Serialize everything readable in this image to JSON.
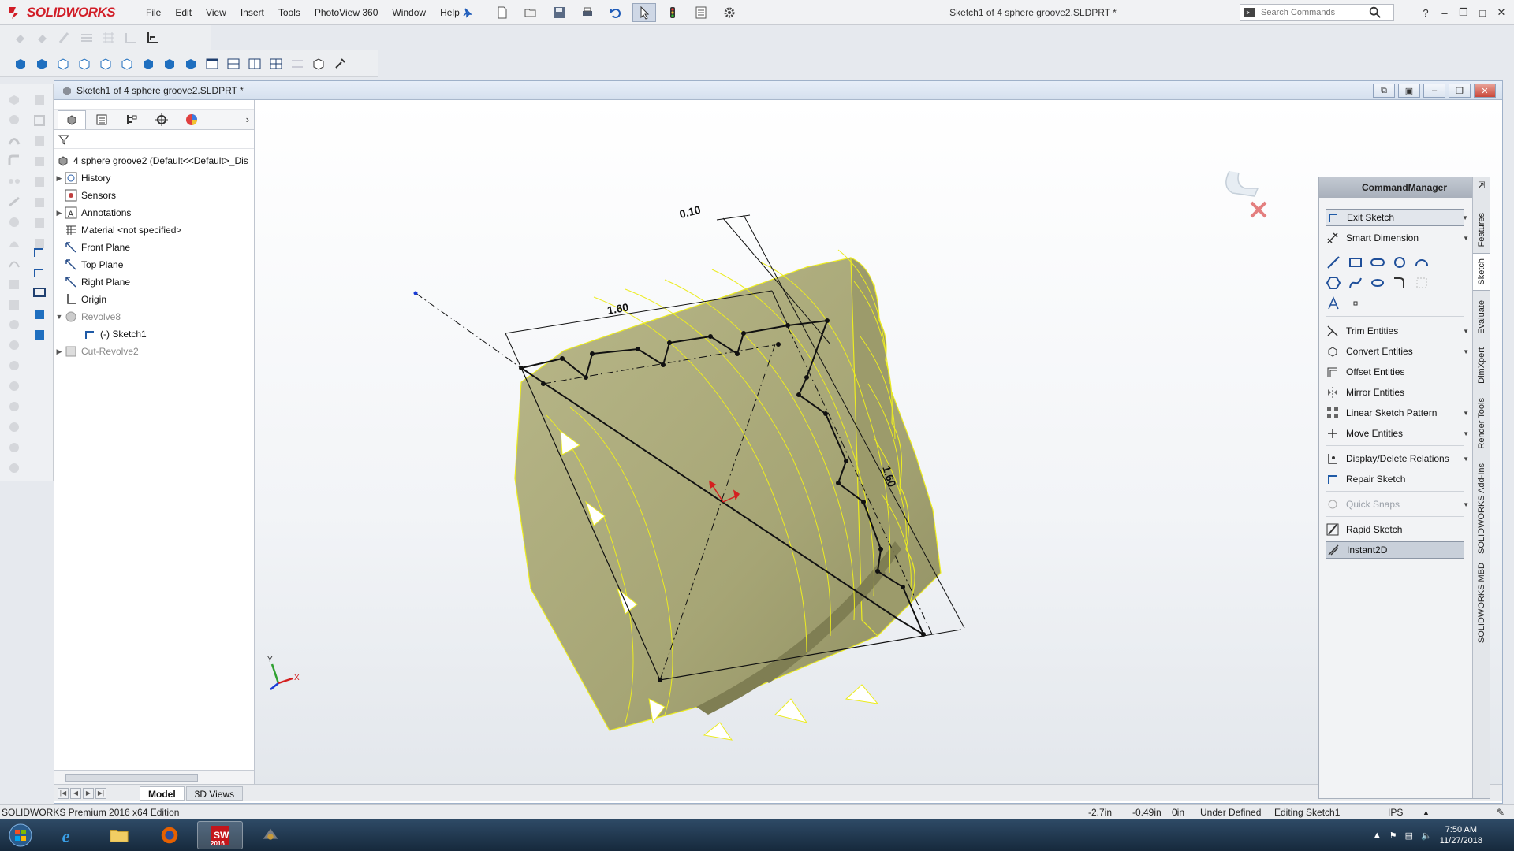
{
  "app": {
    "logo_text": "SOLIDWORKS",
    "window_title": "Sketch1 of 4 sphere groove2.SLDPRT *",
    "menu": [
      "File",
      "Edit",
      "View",
      "Insert",
      "Tools",
      "PhotoView 360",
      "Window",
      "Help"
    ],
    "search_placeholder": "Search Commands"
  },
  "document": {
    "title": "Sketch1 of 4 sphere groove2.SLDPRT *"
  },
  "feature_tree": {
    "root": "4 sphere groove2  (Default<<Default>_Dis",
    "items": [
      {
        "label": "History",
        "expandable": true,
        "icon": "history-icon"
      },
      {
        "label": "Sensors",
        "expandable": false,
        "icon": "sensor-icon"
      },
      {
        "label": "Annotations",
        "expandable": true,
        "icon": "annotations-icon"
      },
      {
        "label": "Material <not specified>",
        "expandable": false,
        "icon": "material-icon"
      },
      {
        "label": "Front Plane",
        "expandable": false,
        "icon": "plane-icon"
      },
      {
        "label": "Top Plane",
        "expandable": false,
        "icon": "plane-icon"
      },
      {
        "label": "Right Plane",
        "expandable": false,
        "icon": "plane-icon"
      },
      {
        "label": "Origin",
        "expandable": false,
        "icon": "origin-icon"
      },
      {
        "label": "Revolve8",
        "expandable": true,
        "expanded": true,
        "icon": "revolve-icon",
        "suppressed": true
      },
      {
        "label": "(-) Sketch1",
        "expandable": false,
        "icon": "sketch-icon",
        "child": true
      },
      {
        "label": "Cut-Revolve2",
        "expandable": true,
        "icon": "cut-revolve-icon",
        "suppressed": true
      }
    ]
  },
  "bottom_tabs": [
    "Model",
    "3D Views"
  ],
  "active_tab": "Model",
  "graphics": {
    "dimensions": [
      "0.10",
      "1.60",
      "1.60"
    ],
    "triad_labels": [
      "Y",
      "X"
    ]
  },
  "command_manager": {
    "title": "CommandManager",
    "commands": [
      "Exit Sketch",
      "Smart Dimension",
      "Trim Entities",
      "Convert Entities",
      "Offset Entities",
      "Mirror Entities",
      "Linear Sketch Pattern",
      "Move Entities",
      "Display/Delete Relations",
      "Repair Sketch",
      "Quick Snaps",
      "Rapid Sketch",
      "Instant2D"
    ],
    "vertical_tabs": [
      "Features",
      "Sketch",
      "Evaluate",
      "DimXpert",
      "Render Tools",
      "SOLIDWORKS Add-Ins",
      "SOLIDWORKS MBD"
    ],
    "active_tab": "Sketch"
  },
  "status": {
    "edition": "SOLIDWORKS Premium 2016 x64 Edition",
    "x": "-2.7in",
    "y": "-0.49in",
    "z": "0in",
    "definition": "Under Defined",
    "mode": "Editing Sketch1",
    "units": "IPS"
  },
  "taskbar": {
    "time": "7:50 AM",
    "date": "11/27/2018",
    "sw_badge": "2016"
  },
  "colors": {
    "model_fill": "#a8a776",
    "model_edge": "#f0f01a",
    "sketch_line": "#111111",
    "brand_red": "#d11d27",
    "taskbar": "#1e3550"
  }
}
